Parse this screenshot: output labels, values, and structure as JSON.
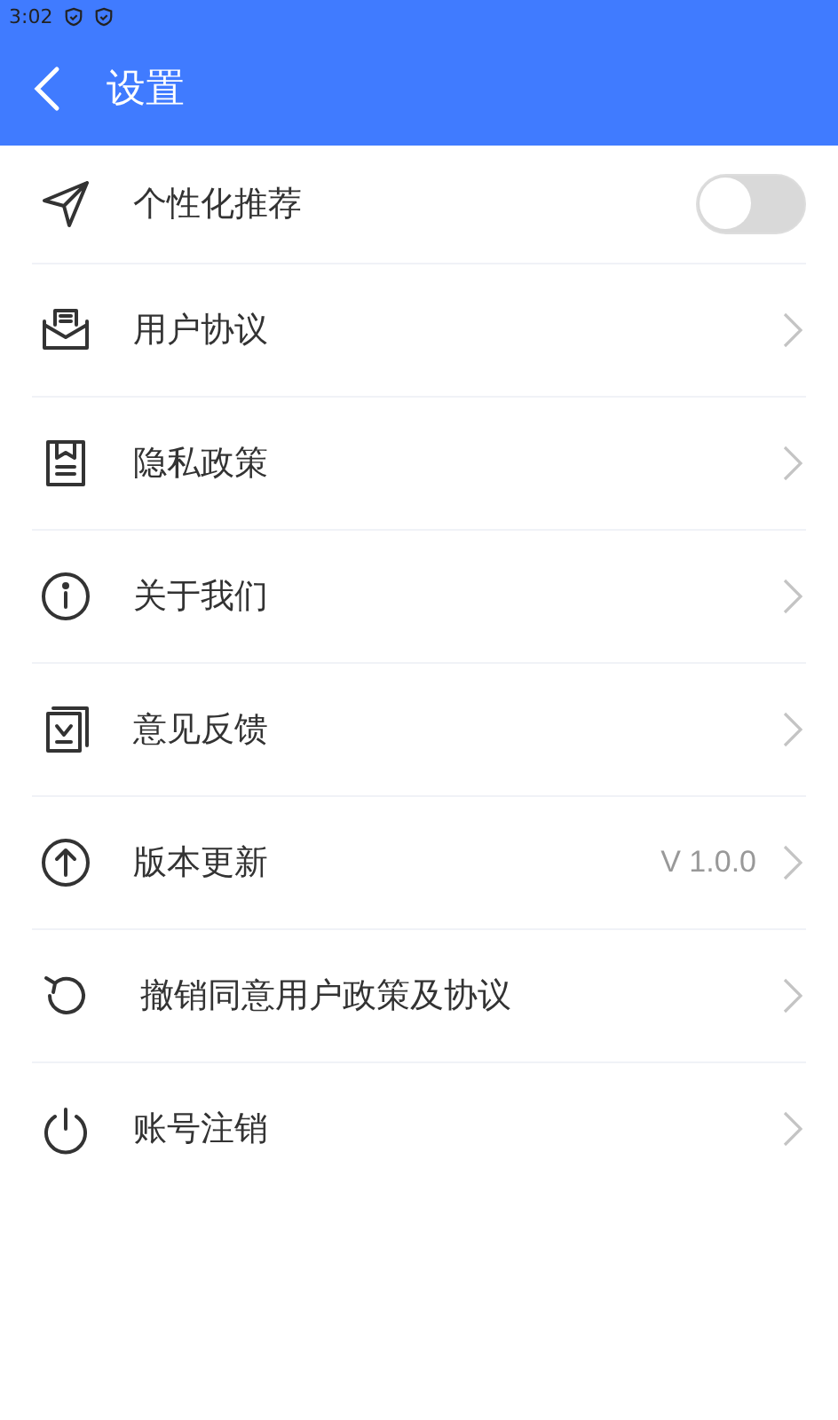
{
  "status_bar": {
    "time": "3:02"
  },
  "header": {
    "title": "设置"
  },
  "items": [
    {
      "kind": "toggle",
      "label": "个性化推荐",
      "on": false
    },
    {
      "kind": "link",
      "label": "用户协议"
    },
    {
      "kind": "link",
      "label": "隐私政策"
    },
    {
      "kind": "link",
      "label": "关于我们"
    },
    {
      "kind": "link",
      "label": "意见反馈"
    },
    {
      "kind": "link",
      "label": "版本更新",
      "value": "V 1.0.0"
    },
    {
      "kind": "link",
      "label": "撤销同意用户政策及协议"
    },
    {
      "kind": "link",
      "label": "账号注销"
    }
  ]
}
